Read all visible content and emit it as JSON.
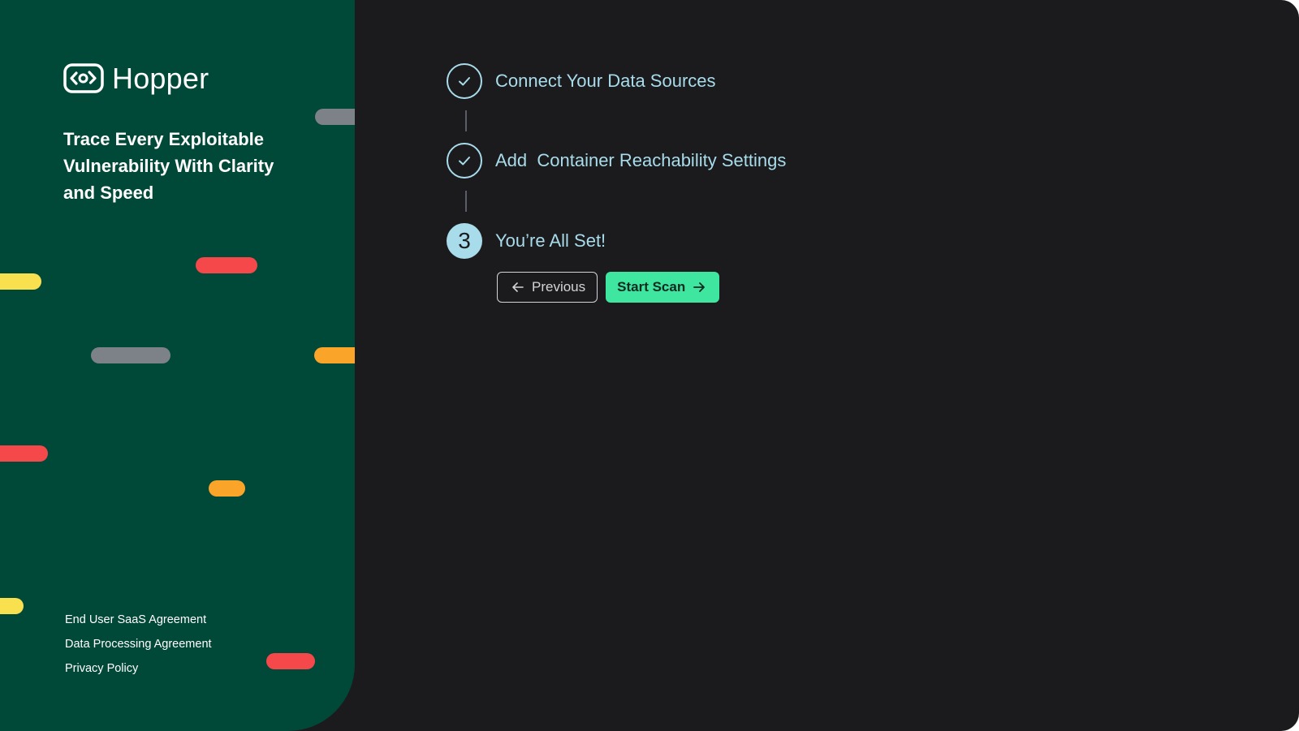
{
  "brand": {
    "name": "Hopper",
    "logo_icon": "hopper-logo-icon",
    "tagline": "Trace Every Exploitable Vulnerability With Clarity and Speed"
  },
  "footer": {
    "links": [
      "End User SaaS Agreement",
      "Data Processing Agreement",
      "Privacy Policy"
    ]
  },
  "decor_colors": {
    "panel_bg": "#004838",
    "red": "#f5484a",
    "yellow": "#f9e04e",
    "orange": "#fba42a",
    "gray": "#7d8288"
  },
  "steps": [
    {
      "status": "complete",
      "icon": "check-icon",
      "label": "Connect Your Data Sources"
    },
    {
      "status": "complete",
      "icon": "check-icon",
      "label": "Add  Container Reachability Settings"
    },
    {
      "status": "current",
      "number": "3",
      "label": "You’re All Set!"
    }
  ],
  "actions": {
    "previous_label": "Previous",
    "previous_icon": "arrow-left-icon",
    "start_label": "Start Scan",
    "start_icon": "arrow-right-icon"
  },
  "colors": {
    "background": "#1b1b1e",
    "accent": "#a8dcea",
    "primary_button": "#3ee6a0"
  }
}
